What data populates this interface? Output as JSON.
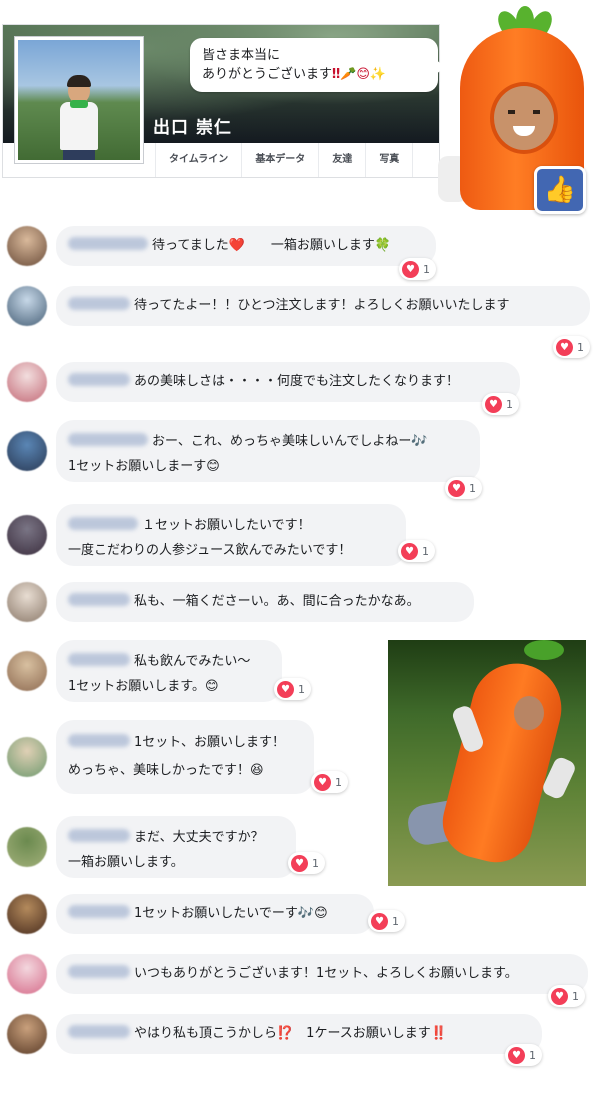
{
  "profile": {
    "name": "出口 崇仁",
    "tabs": [
      "タイムライン",
      "基本データ",
      "友達",
      "写真"
    ]
  },
  "speech_bubble": {
    "line1": "皆さま本当に",
    "line2": "ありがとうございます",
    "emojis": "‼🥕😊✨"
  },
  "comments": [
    {
      "lines": [
        "待ってました❤️　　一箱お願いします🍀"
      ],
      "reactions": "1"
    },
    {
      "lines": [
        "待ってたよー！！ひとつ注文します！よろしくお願いいたします"
      ],
      "reactions": "1"
    },
    {
      "lines": [
        "あの美味しさは・・・・何度でも注文したくなります！"
      ],
      "reactions": "1"
    },
    {
      "lines": [
        "おー、これ、めっちゃ美味しいんでしよねー🎶",
        "1セットお願いしまーす😊"
      ],
      "reactions": "1"
    },
    {
      "lines": [
        "１セットお願いしたいです！",
        "一度こだわりの人参ジュース飲んでみたいです！"
      ],
      "reactions": "1"
    },
    {
      "lines": [
        "私も、一箱くださーい。あ、間に合ったかなあ。"
      ],
      "reactions": ""
    },
    {
      "lines": [
        "私も飲んでみたい〜",
        "1セットお願いします。😊"
      ],
      "reactions": "1"
    },
    {
      "lines": [
        "1セット、お願いします！",
        "めっちゃ、美味しかったです！😆"
      ],
      "reactions": "1"
    },
    {
      "lines": [
        "まだ、大丈夫ですか？",
        "一箱お願いします。"
      ],
      "reactions": "1"
    },
    {
      "lines": [
        "1セットお願いしたいでーす🎶😊"
      ],
      "reactions": "1"
    },
    {
      "lines": [
        "いつもありがとうございます！1セット、よろしくお願いします。"
      ],
      "reactions": "1"
    },
    {
      "lines": [
        "やはり私も頂こうかしら⁉️　1ケースお願いします‼️"
      ],
      "reactions": "1"
    }
  ],
  "colors": {
    "bubble_bg": "#f2f3f5",
    "heart": "#f33e58",
    "like_blue": "#4267b2",
    "carrot_orange": "#ff7d24"
  }
}
